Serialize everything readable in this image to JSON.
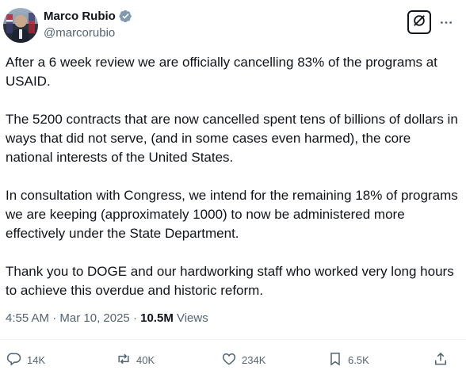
{
  "author": {
    "display_name": "Marco Rubio",
    "handle": "@marcorubio",
    "verified_color": "#829aab"
  },
  "header": {
    "grok_icon": "grok-icon",
    "more_icon": "more-horizontal-icon"
  },
  "tweet": {
    "paragraphs": [
      "After a 6 week review we are officially cancelling  83%  of the programs at USAID.",
      "The 5200 contracts that are now cancelled spent tens of billions of dollars in ways that did not serve, (and in some cases even harmed), the core national interests of the United States.",
      "In consultation with Congress, we intend for the remaining 18% of programs we are keeping (approximately 1000) to now be administered more effectively under the State Department.",
      "Thank you to DOGE and our hardworking staff who worked very long hours to achieve this overdue and historic reform."
    ]
  },
  "meta": {
    "time": "4:55 AM",
    "separator": " · ",
    "date": "Mar 10, 2025",
    "views_count": "10.5M",
    "views_label": " Views"
  },
  "actions": {
    "replies": "14K",
    "reposts": "40K",
    "likes": "234K",
    "bookmarks": "6.5K"
  },
  "colors": {
    "text_primary": "#0f1419",
    "text_secondary": "#536471",
    "divider": "#eff3f4"
  }
}
